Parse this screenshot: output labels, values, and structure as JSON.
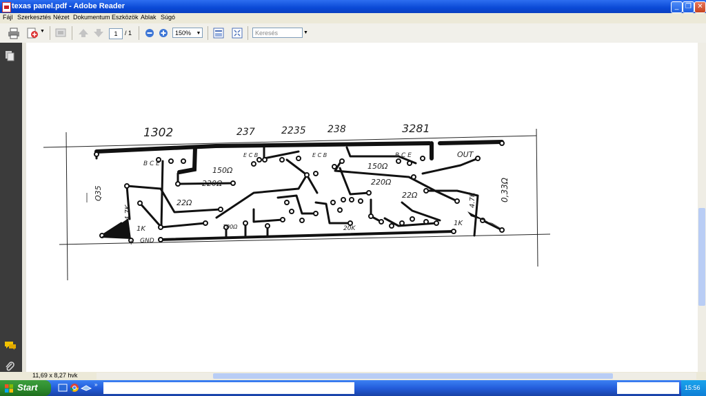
{
  "window": {
    "title": "texas panel.pdf - Adobe Reader"
  },
  "menu": [
    "Fájl",
    "Szerkesztés",
    "Nézet",
    "Dokumentum",
    "Eszközök",
    "Ablak",
    "Súgó"
  ],
  "toolbar": {
    "page_current": "1",
    "page_total": "/ 1",
    "zoom": "150%",
    "search_placeholder": "Keresés"
  },
  "document": {
    "labels": {
      "t1": "1302",
      "t2": "237",
      "t3": "2235",
      "t4": "238",
      "t5": "3281",
      "out": "OUT",
      "left_v": "Q35",
      "right_v": "0,33Ω",
      "r150a": "150Ω",
      "r220a": "220Ω",
      "r22a": "22Ω",
      "r150b": "150Ω",
      "r220b": "220Ω",
      "r22b": "22Ω",
      "gnd": "GND",
      "plus": "+",
      "k1a": "1K",
      "k1b": "1K",
      "r47a": "4.7K",
      "r47b": "4.7K",
      "bce1": "B C E",
      "bce2": "E C B",
      "bce3": "E C B",
      "bce4": "B C E",
      "r20k": "20K",
      "r100": "100Ω"
    }
  },
  "status": {
    "page_size": "11,69 x 8,27 hvk"
  },
  "taskbar": {
    "start": "Start",
    "clock": "15:56"
  },
  "colors": {
    "titlebar": "#0a49d6",
    "taskbar": "#245ddb",
    "start": "#2f8d2f",
    "navpanel": "#3b3b3b"
  }
}
